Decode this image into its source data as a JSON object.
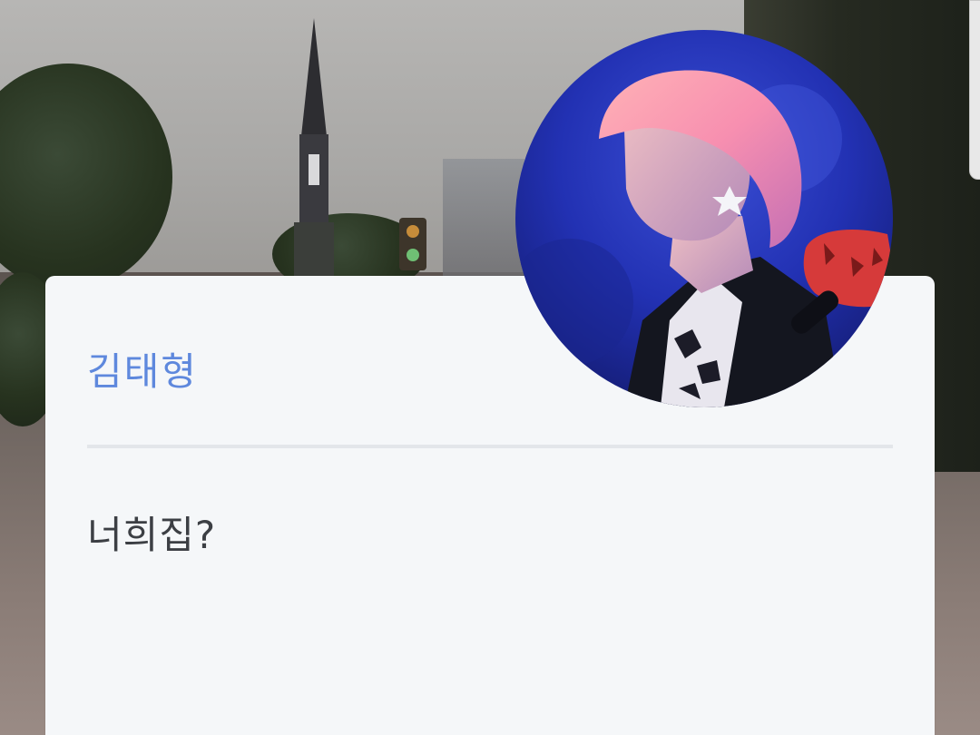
{
  "profile": {
    "name": "김태형",
    "message": "너희집?"
  },
  "icons": {
    "avatar": "profile-photo",
    "background": "background-photo"
  },
  "colors": {
    "name_accent": "#5e88dd",
    "message_text": "#3c3f44",
    "card_background": "#f5f7f9",
    "divider": "#e3e6ea"
  }
}
